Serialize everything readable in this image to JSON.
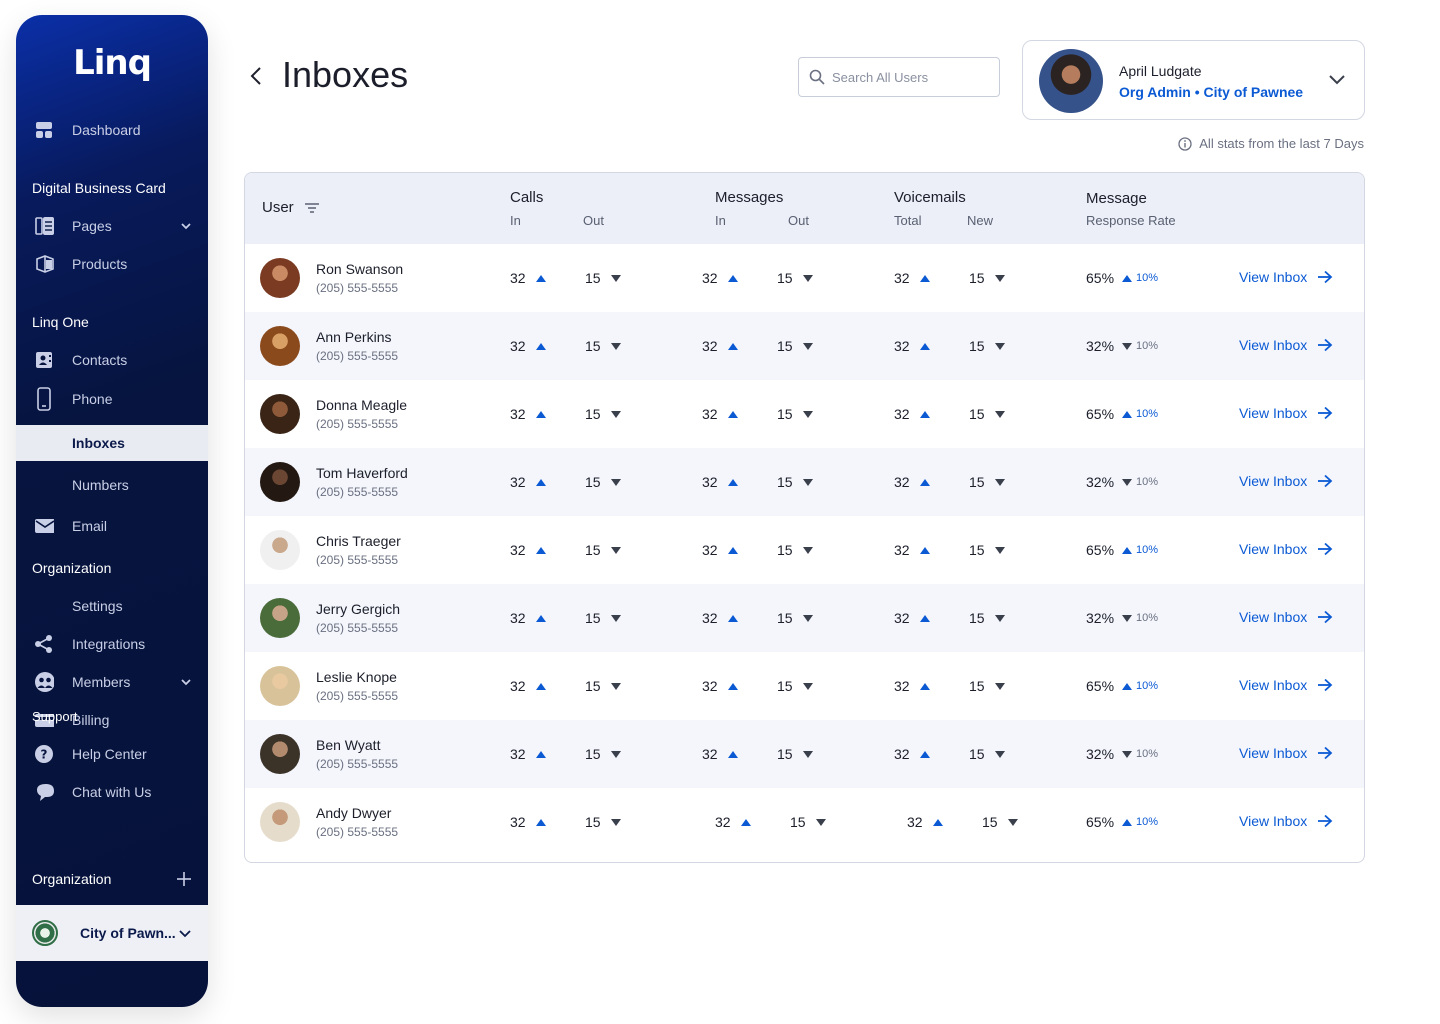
{
  "sidebar": {
    "logo": "Linq",
    "dashboard": "Dashboard",
    "section_dbc": "Digital Business Card",
    "pages": "Pages",
    "products": "Products",
    "section_linq_one": "Linq One",
    "contacts": "Contacts",
    "phone": "Phone",
    "inboxes": "Inboxes",
    "numbers": "Numbers",
    "email": "Email",
    "section_org": "Organization",
    "settings": "Settings",
    "integrations": "Integrations",
    "members": "Members",
    "billing": "Billing",
    "section_support": "Support",
    "help_center": "Help Center",
    "chat": "Chat with Us",
    "org_footer": "Organization",
    "org_name": "City of Pawn..."
  },
  "header": {
    "title": "Inboxes",
    "search_placeholder": "Search All Users",
    "user_name": "April Ludgate",
    "user_role": "Org Admin • City of Pawnee",
    "stats_note": "All stats from the last 7 Days"
  },
  "table": {
    "col_user": "User",
    "col_calls": "Calls",
    "col_messages": "Messages",
    "col_voicemails": "Voicemails",
    "col_rate": "Message",
    "sub_in": "In",
    "sub_out": "Out",
    "sub_total": "Total",
    "sub_new": "New",
    "sub_rate": "Response Rate",
    "link_label": "View Inbox",
    "rows": [
      {
        "name": "Ron Swanson",
        "phone": "(205) 555-5555",
        "calls_in": "32",
        "calls_out": "15",
        "msg_in": "32",
        "msg_out": "15",
        "vm_total": "32",
        "vm_new": "15",
        "rate": "65%",
        "delta": "10%",
        "delta_dir": "up"
      },
      {
        "name": "Ann Perkins",
        "phone": "(205) 555-5555",
        "calls_in": "32",
        "calls_out": "15",
        "msg_in": "32",
        "msg_out": "15",
        "vm_total": "32",
        "vm_new": "15",
        "rate": "32%",
        "delta": "10%",
        "delta_dir": "down"
      },
      {
        "name": "Donna Meagle",
        "phone": "(205) 555-5555",
        "calls_in": "32",
        "calls_out": "15",
        "msg_in": "32",
        "msg_out": "15",
        "vm_total": "32",
        "vm_new": "15",
        "rate": "65%",
        "delta": "10%",
        "delta_dir": "up"
      },
      {
        "name": "Tom Haverford",
        "phone": "(205) 555-5555",
        "calls_in": "32",
        "calls_out": "15",
        "msg_in": "32",
        "msg_out": "15",
        "vm_total": "32",
        "vm_new": "15",
        "rate": "32%",
        "delta": "10%",
        "delta_dir": "down"
      },
      {
        "name": "Chris Traeger",
        "phone": "(205) 555-5555",
        "calls_in": "32",
        "calls_out": "15",
        "msg_in": "32",
        "msg_out": "15",
        "vm_total": "32",
        "vm_new": "15",
        "rate": "65%",
        "delta": "10%",
        "delta_dir": "up"
      },
      {
        "name": "Jerry Gergich",
        "phone": "(205) 555-5555",
        "calls_in": "32",
        "calls_out": "15",
        "msg_in": "32",
        "msg_out": "15",
        "vm_total": "32",
        "vm_new": "15",
        "rate": "32%",
        "delta": "10%",
        "delta_dir": "down"
      },
      {
        "name": "Leslie Knope",
        "phone": "(205) 555-5555",
        "calls_in": "32",
        "calls_out": "15",
        "msg_in": "32",
        "msg_out": "15",
        "vm_total": "32",
        "vm_new": "15",
        "rate": "65%",
        "delta": "10%",
        "delta_dir": "up"
      },
      {
        "name": "Ben Wyatt",
        "phone": "(205) 555-5555",
        "calls_in": "32",
        "calls_out": "15",
        "msg_in": "32",
        "msg_out": "15",
        "vm_total": "32",
        "vm_new": "15",
        "rate": "32%",
        "delta": "10%",
        "delta_dir": "down"
      },
      {
        "name": "Andy Dwyer",
        "phone": "(205) 555-5555",
        "calls_in": "32",
        "calls_out": "15",
        "msg_in": "32",
        "msg_out": "15",
        "vm_total": "32",
        "vm_new": "15",
        "rate": "65%",
        "delta": "10%",
        "delta_dir": "up"
      }
    ]
  },
  "colors": {
    "accent": "#0b5ad4",
    "sidebar_bg": "#06143f",
    "row_alt": "#f4f6fc"
  }
}
